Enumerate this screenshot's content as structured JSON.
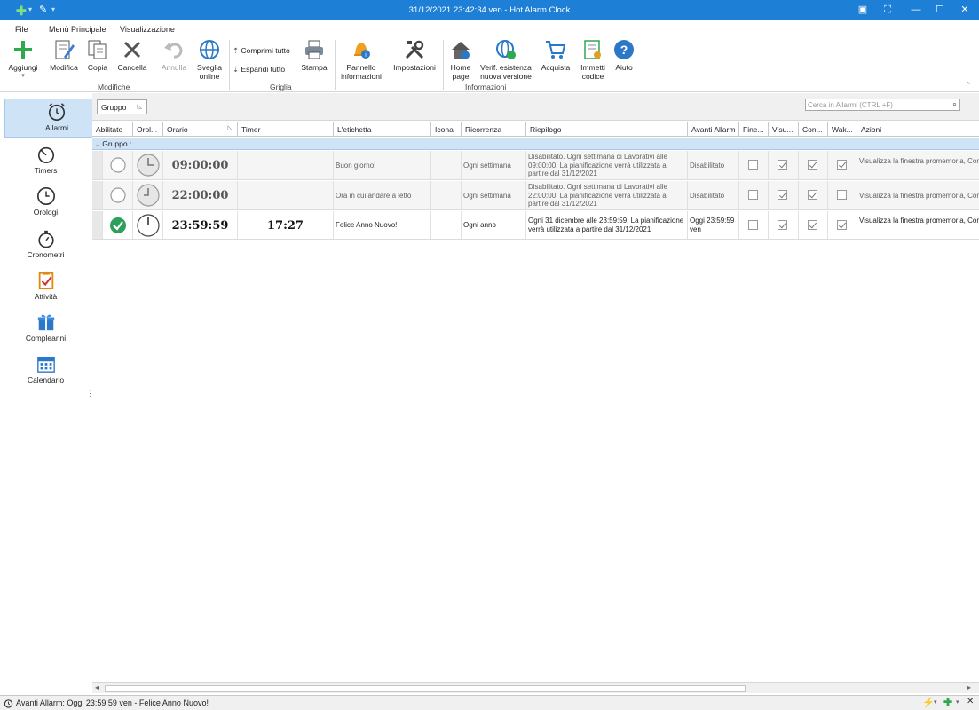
{
  "window": {
    "title": "31/12/2021 23:42:34 ven - Hot Alarm Clock"
  },
  "menu": {
    "tabs": [
      "File",
      "Menù Principale",
      "Visualizzazione"
    ]
  },
  "ribbon": {
    "add_label": "Aggiungi",
    "edit_label": "Modifica",
    "copy_label": "Copia",
    "delete_label": "Cancella",
    "undo_label": "Annulla",
    "wakeup_online_label": "Sveglia online",
    "modifiche_group": "Modifiche",
    "collapse_all_label": "Comprimi tutto",
    "expand_all_label": "Espandi tutto",
    "print_label": "Stampa",
    "griglia_group": "Griglia",
    "info_panel_label": "Pannello informazioni",
    "settings_label": "Impostazioni",
    "home_page_label": "Home page",
    "check_version_label": "Verif. esistenza nuova versione",
    "buy_label": "Acquista",
    "enter_code_label": "Immetti codice",
    "help_label": "Aiuto",
    "informazioni_group": "Informazioni"
  },
  "sidebar": {
    "items": [
      "Allarmi",
      "Timers",
      "Orologi",
      "Cronometri",
      "Attività",
      "Compleanni",
      "Calendario"
    ]
  },
  "grid": {
    "group_chip": "Gruppo",
    "search_placeholder": "Cerca in Allarmi (CTRL +F)",
    "headers": [
      "Abilitato",
      "Orol...",
      "Orario",
      "Timer",
      "L'etichetta",
      "Icona",
      "Ricorrenza",
      "Riepilogo",
      "Avanti Allarm",
      "Fine...",
      "Visu...",
      "Con...",
      "Wak...",
      "Azioni"
    ],
    "group_row": "Gruppo :",
    "rows": [
      {
        "enabled": false,
        "time": "09:00:00",
        "timer": "",
        "label": "Buon giorno!",
        "recurrence": "Ogni settimana",
        "summary": "Disabilitato. Ogni settimana di Lavorativi alle 09:00:00. La pianificazione verrà utilizzata a partire dal 31/12/2021",
        "next_alarm": "Disabilitato",
        "checks": [
          false,
          true,
          true,
          true
        ],
        "actions": "Visualizza la finestra promemoria, Con up del computer dalla modalità sleep"
      },
      {
        "enabled": false,
        "time": "22:00:00",
        "timer": "",
        "label": "Ora in cui andare a letto",
        "recurrence": "Ogni settimana",
        "summary": "Disabilitato. Ogni settimana di Lavorativi alle 22:00:00. La pianificazione verrà utilizzata a partire dal 31/12/2021",
        "next_alarm": "Disabilitato",
        "checks": [
          false,
          true,
          true,
          false
        ],
        "actions": "Visualizza la finestra promemoria, Con"
      },
      {
        "enabled": true,
        "time": "23:59:59",
        "timer": "17:27",
        "label": "Felice Anno Nuovo!",
        "recurrence": "Ogni anno",
        "summary": "Ogni 31 dicembre alle 23:59:59. La pianificazione verrà utilizzata a partire dal 31/12/2021",
        "next_alarm": "Oggi 23:59:59 ven",
        "checks": [
          false,
          true,
          true,
          true
        ],
        "actions": "Visualizza la finestra promemoria, Con up del computer dalla modalità sleep"
      }
    ]
  },
  "status": {
    "text": "Avanti Allarm: Oggi 23:59:59 ven - Felice Anno Nuovo!"
  },
  "colors": {
    "titlebar": "#1e7fd6",
    "selected_nav": "#cfe3f7",
    "enabled_green": "#2e9e5b"
  }
}
